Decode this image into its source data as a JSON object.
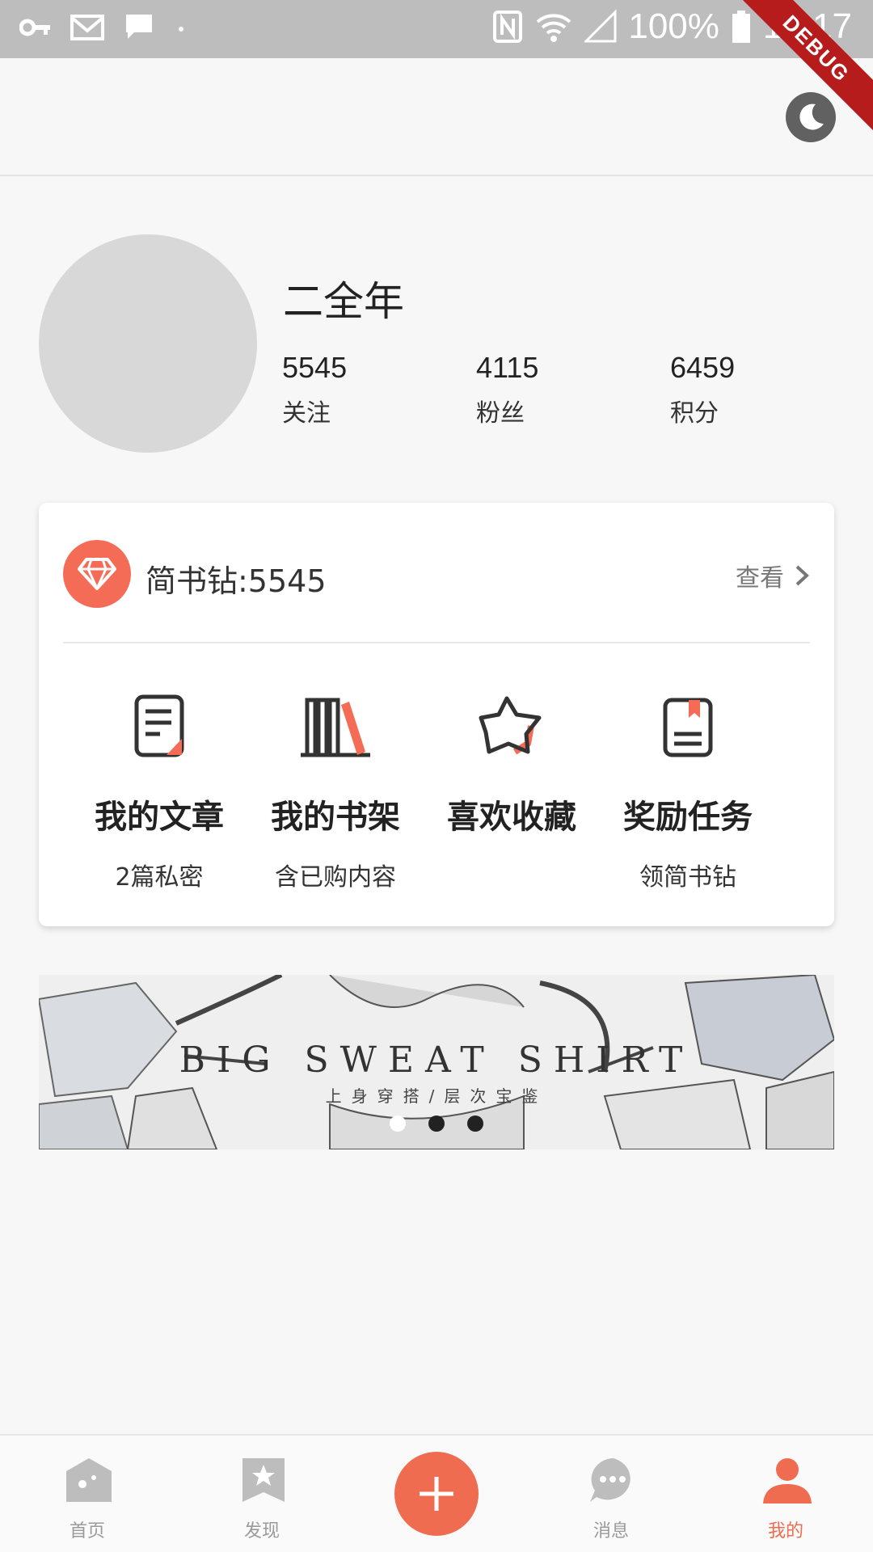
{
  "status_bar": {
    "battery": "100%",
    "time": "15:17",
    "debug_label": "DEBUG"
  },
  "profile": {
    "name": "二全年",
    "stats": [
      {
        "value": "5545",
        "label": "关注"
      },
      {
        "value": "4115",
        "label": "粉丝"
      },
      {
        "value": "6459",
        "label": "积分"
      }
    ]
  },
  "card": {
    "diamond_label": "简书钻:5545",
    "view_label": "查看",
    "features": [
      {
        "title": "我的文章",
        "subtitle": "2篇私密",
        "icon": "article-icon"
      },
      {
        "title": "我的书架",
        "subtitle": "含已购内容",
        "icon": "bookshelf-icon"
      },
      {
        "title": "喜欢收藏",
        "subtitle": "",
        "icon": "star-icon"
      },
      {
        "title": "奖励任务",
        "subtitle": "领简书钻",
        "icon": "bookmark-book-icon"
      }
    ]
  },
  "banner": {
    "headline": "BIG SWEAT SHIRT",
    "subline": "上身穿搭/层次宝鉴",
    "slide_count": 3,
    "active_slide": 0
  },
  "bottom_nav": {
    "items": [
      {
        "label": "首页",
        "icon": "home-icon"
      },
      {
        "label": "发现",
        "icon": "discover-icon"
      },
      {
        "label": "消息",
        "icon": "message-icon"
      },
      {
        "label": "我的",
        "icon": "profile-icon"
      }
    ],
    "active": "我的"
  },
  "colors": {
    "accent": "#ef6c50",
    "status_bar": "#bdbdbd",
    "background": "#f7f7f7"
  }
}
